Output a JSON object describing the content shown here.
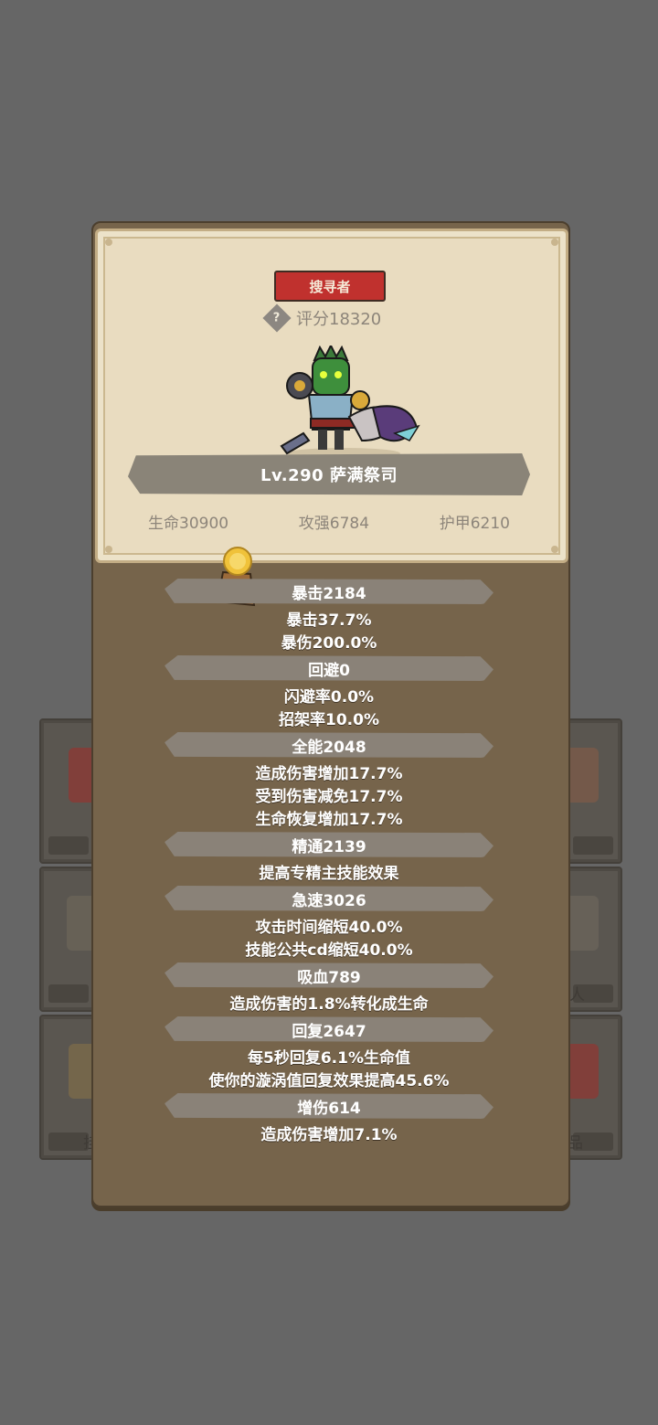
{
  "hero": {
    "tag": "搜寻者",
    "score": "评分18320",
    "name": "Lv.290 萨满祭司",
    "hp": "生命30900",
    "attack": "攻强6784",
    "armor": "护甲6210"
  },
  "background_labels": {
    "left_bottom": "挂",
    "right_middle": "人",
    "right_bottom": "品"
  },
  "attributes": [
    {
      "title": "暴击2184",
      "lines": [
        "暴击37.7%",
        "暴伤200.0%"
      ]
    },
    {
      "title": "回避0",
      "lines": [
        "闪避率0.0%",
        "招架率10.0%"
      ]
    },
    {
      "title": "全能2048",
      "lines": [
        "造成伤害增加17.7%",
        "受到伤害减免17.7%",
        "生命恢复增加17.7%"
      ]
    },
    {
      "title": "精通2139",
      "lines": [
        "提高专精主技能效果"
      ]
    },
    {
      "title": "急速3026",
      "lines": [
        "攻击时间缩短40.0%",
        "技能公共cd缩短40.0%"
      ]
    },
    {
      "title": "吸血789",
      "lines": [
        "造成伤害的1.8%转化成生命"
      ]
    },
    {
      "title": "回复2647",
      "lines": [
        "每5秒回复6.1%生命值",
        "使你的漩涡值回复效果提高45.6%"
      ]
    },
    {
      "title": "增伤614",
      "lines": [
        "造成伤害增加7.1%"
      ]
    }
  ],
  "colors": {
    "tag_red": "#c0312e",
    "panel_brown": "#76644b",
    "parchment": "#e9dcc0"
  }
}
